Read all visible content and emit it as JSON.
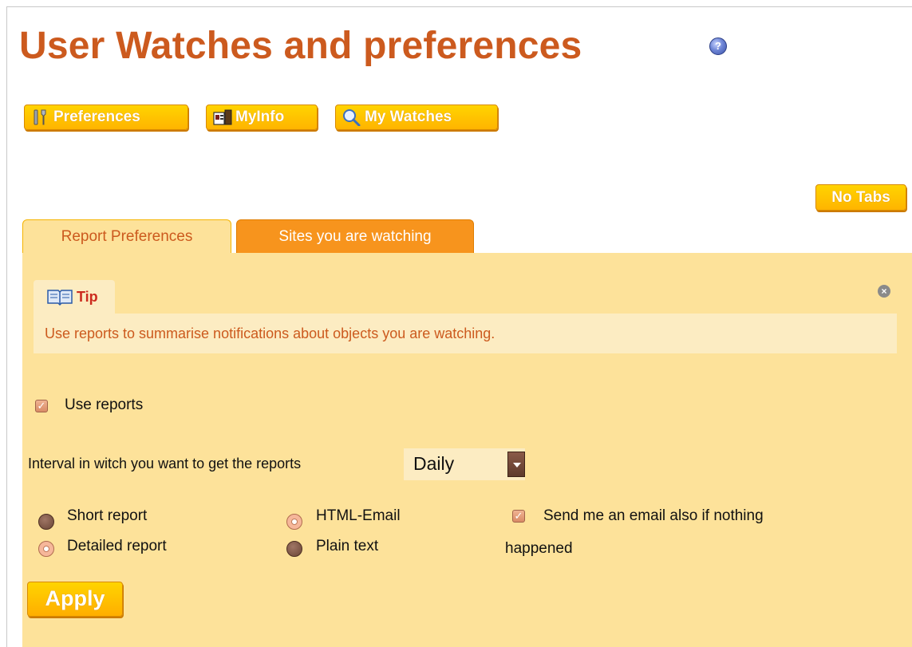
{
  "page": {
    "title": "User Watches and preferences",
    "help_icon": "help-icon",
    "help_glyph": "?"
  },
  "toolbar": {
    "preferences_label": "Preferences",
    "myinfo_label": "MyInfo",
    "mywatches_label": "My Watches",
    "no_tabs_label": "No Tabs"
  },
  "tabs": [
    {
      "label": "Report Preferences",
      "active": true
    },
    {
      "label": "Sites you are watching",
      "active": false
    }
  ],
  "tip": {
    "title": "Tip",
    "text": "Use reports to summarise notifications about objects you are watching.",
    "close_glyph": "×"
  },
  "form": {
    "use_reports_label": "Use reports",
    "use_reports_checked": true,
    "interval_label": "Interval in witch you want to get the reports",
    "interval_value": "Daily",
    "report_types": [
      {
        "label": "Short report",
        "selected": false
      },
      {
        "label": "Detailed report",
        "selected": true
      }
    ],
    "formats": [
      {
        "label": "HTML-Email",
        "selected": true
      },
      {
        "label": "Plain text",
        "selected": false
      }
    ],
    "send_email_label": "Send me an email also if nothing",
    "send_email_label_cont": "happened",
    "send_email_checked": true,
    "apply_label": "Apply"
  },
  "colors": {
    "title": "#cc5a1e",
    "button": "#ffc400",
    "active_tab": "#fde29a",
    "inactive_tab": "#f7941d",
    "panel": "#fde29a"
  }
}
